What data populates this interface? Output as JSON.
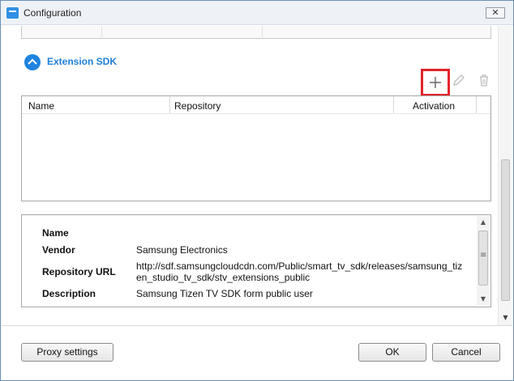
{
  "window": {
    "title": "Configuration",
    "close_glyph": "✕"
  },
  "section": {
    "title": "Extension SDK",
    "toggle_state": "expanded"
  },
  "toolbar": {
    "add_icon": "plus-icon",
    "edit_icon": "pencil-icon",
    "delete_icon": "trash-icon"
  },
  "table": {
    "columns": [
      "Name",
      "Repository",
      "Activation"
    ],
    "rows": []
  },
  "details": {
    "name_label": "Name",
    "name_value": "",
    "vendor_label": "Vendor",
    "vendor_value": "Samsung Electronics",
    "repo_label": "Repository URL",
    "repo_value": "http://sdf.samsungcloudcdn.com/Public/smart_tv_sdk/releases/samsung_tizen_studio_tv_sdk/stv_extensions_public",
    "desc_label": "Description",
    "desc_value": "Samsung Tizen TV SDK form public user"
  },
  "buttons": {
    "proxy": "Proxy settings",
    "ok": "OK",
    "cancel": "Cancel"
  },
  "colors": {
    "accent": "#1f83e0",
    "highlight": "#e3252b"
  }
}
